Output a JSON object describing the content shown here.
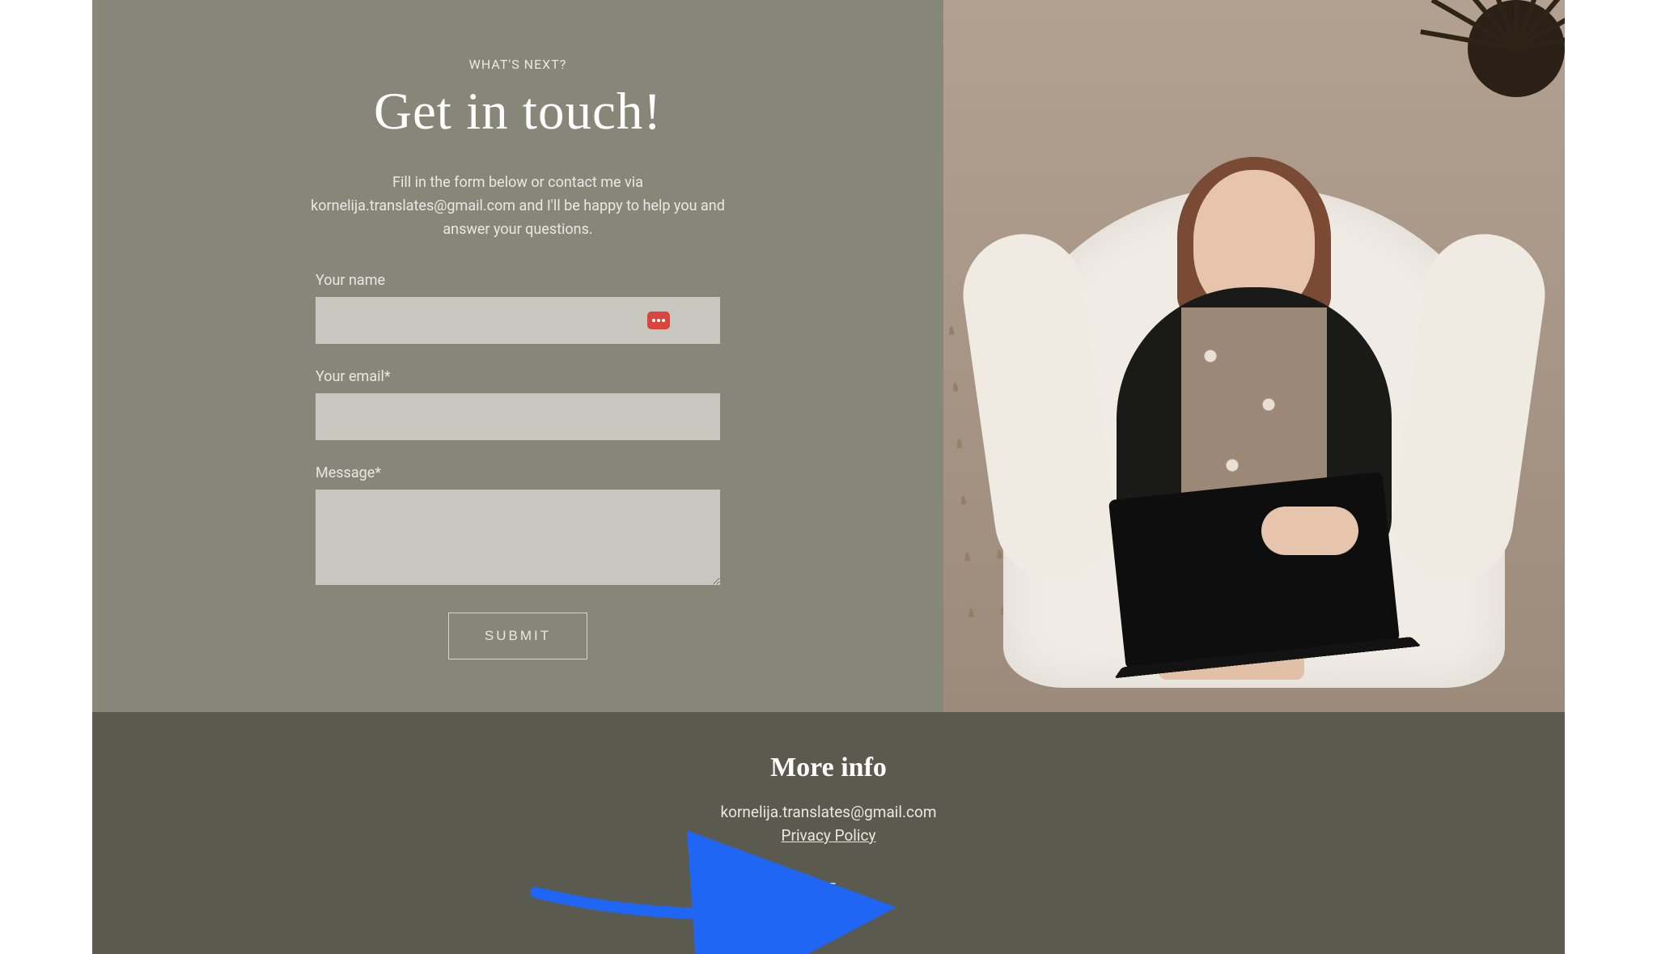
{
  "contact": {
    "eyebrow": "WHAT'S NEXT?",
    "heading": "Get in touch!",
    "intro": "Fill in the form below or contact me via kornelija.translates@gmail.com and I'll be happy to help you and answer your questions.",
    "form": {
      "name_label": "Your name",
      "name_value": "",
      "email_label": "Your email*",
      "email_value": "",
      "message_label": "Message*",
      "message_value": "",
      "submit_label": "SUBMIT"
    }
  },
  "image": {
    "alt": "Portrait of a woman with auburn bob haircut wearing a black blazer over a tan polka-dot dress, sitting in a cream boucle armchair with a black laptop on her lap, dried pampas grass to the left and a dark sunburst wall decoration top-right."
  },
  "footer": {
    "heading": "More info",
    "email": "kornelija.translates@gmail.com",
    "privacy_label": "Privacy Policy",
    "language_label": "LT"
  },
  "annotation": {
    "arrow_color": "#1f66f4"
  }
}
